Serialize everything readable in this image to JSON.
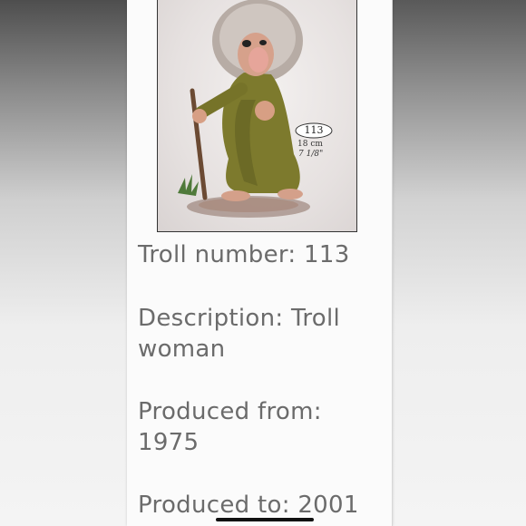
{
  "image": {
    "badge_number": "113",
    "size_cm": "18 cm",
    "size_in": "7 1/8\""
  },
  "details": {
    "troll_number": "Troll number: 113",
    "description_line1": "Description: Troll",
    "description_line2": "woman",
    "produced_from_line1": "Produced from:",
    "produced_from_line2": "1975",
    "produced_to": "Produced to: 2001"
  }
}
